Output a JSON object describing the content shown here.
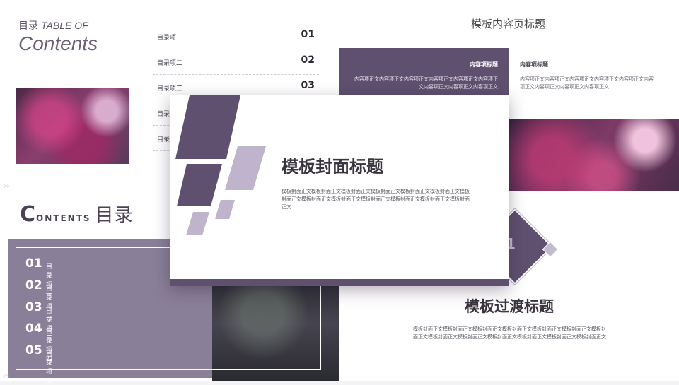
{
  "toc_slide": {
    "title_cn": "目录",
    "title_en": "TABLE OF",
    "contents_word": "Contents",
    "items": [
      {
        "label": "目录项一",
        "num": "01"
      },
      {
        "label": "目录项二",
        "num": "02"
      },
      {
        "label": "目录项三",
        "num": "03"
      },
      {
        "label": "目录项四",
        "num": ""
      },
      {
        "label": "目录项五",
        "num": ""
      }
    ]
  },
  "content_slide": {
    "title": "模板内容页标题",
    "band_heading": "内容项标题",
    "band_body": "内容项正文内容项正文内容项正文内容项正文内容项正文内容项正文内容项正文内容项正文内容项正文",
    "heading": "内容项标题",
    "body": "内容项正文内容项正文内容项正文内容项正文内容项正文内容项正文内容项正文内容项正文内容项正文"
  },
  "contents_slide": {
    "title_big": "C",
    "title_rest": "ONTENTS",
    "title_cn": "目录",
    "items": [
      {
        "num": "01",
        "label": "目录项一"
      },
      {
        "num": "02",
        "label": "目录项二"
      },
      {
        "num": "03",
        "label": "目录项三"
      },
      {
        "num": "04",
        "label": "目录项四"
      },
      {
        "num": "05",
        "label": "目录项五"
      }
    ]
  },
  "transition_slide": {
    "number": "1",
    "title": "模板过渡标题",
    "body": "模板封面正文模板封面正文模板封面正文模板封面正文模板封面正文模板封面正文模板封面正文模板封面正文模板封面正文模板封面正文模板封面正文模板封面正文模板封面正文"
  },
  "cover_slide": {
    "title": "模板封面标题",
    "body": "模板封面正文模板封面正文模板封面正文模板封面正文模板封面正文模板封面正文模板封面正文模板封面正文模板封面正文模板封面正文模板封面正文模板封面正文模板封面正文"
  },
  "colors": {
    "accent": "#5f5070",
    "accent_light": "#bfb4cc",
    "panel": "#8a7f98"
  }
}
